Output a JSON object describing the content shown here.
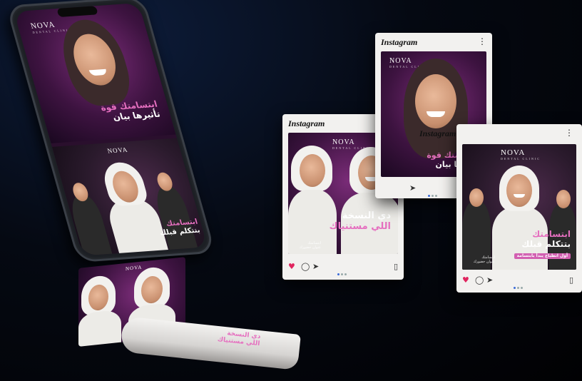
{
  "brand": {
    "logo": "NOVA",
    "logo_subtitle": "DENTAL CLINIC"
  },
  "instagram": {
    "label": "Instagram",
    "more_icon": "more-vertical-icon",
    "like_icon": "heart-icon",
    "comment_icon": "comment-icon",
    "share_icon": "send-icon",
    "save_icon": "bookmark-icon",
    "liked_color": "#e0245e"
  },
  "posts": {
    "woman": {
      "line1": "ابتسامتك قوة",
      "line2": "تأثيرها بيان"
    },
    "two_men": {
      "line1": "دي النسخة",
      "line2": "اللي مستنياك"
    },
    "group": {
      "line1": "ابتسامتك",
      "line2": "بتتكلم قبلك",
      "tagline": "أول انطباع يبدأ بابتسامة"
    },
    "credit": "ابتسامتك\nعنوان حضورك"
  },
  "colors": {
    "accent_pink": "#e56fbf",
    "card_bg": "#f2f1ef",
    "background": "#050912"
  }
}
